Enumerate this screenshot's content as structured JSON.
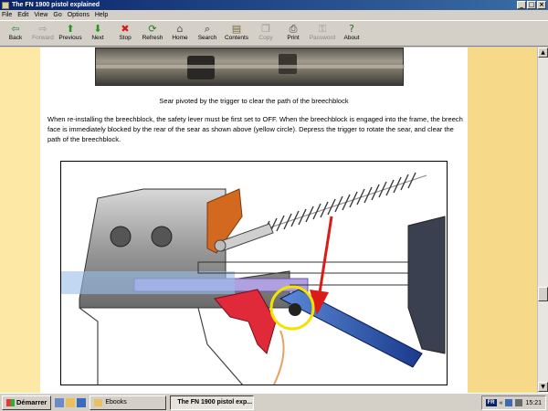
{
  "window": {
    "title": "The FN 1900 pistol explained",
    "buttons": [
      "_",
      "□",
      "×"
    ]
  },
  "menu": [
    "File",
    "Edit",
    "View",
    "Go",
    "Options",
    "Help"
  ],
  "toolbar": [
    {
      "label": "Back",
      "icon": "back-arrow-icon",
      "glyph": "⇦",
      "color": "#2a8a2a",
      "enabled": true
    },
    {
      "label": "Forward",
      "icon": "forward-arrow-icon",
      "glyph": "⇨",
      "color": "#9a9a9a",
      "enabled": false
    },
    {
      "label": "Previous",
      "icon": "up-arrow-icon",
      "glyph": "⬆",
      "color": "#1f9a1f",
      "enabled": true
    },
    {
      "label": "Next",
      "icon": "down-arrow-icon",
      "glyph": "⬇",
      "color": "#1f9a1f",
      "enabled": true
    },
    {
      "label": "Stop",
      "icon": "stop-icon",
      "glyph": "✖",
      "color": "#d21a1a",
      "enabled": true
    },
    {
      "label": "Refresh",
      "icon": "refresh-icon",
      "glyph": "⟳",
      "color": "#2a7a2a",
      "enabled": true
    },
    {
      "label": "Home",
      "icon": "home-icon",
      "glyph": "⌂",
      "color": "#5a5a5a",
      "enabled": true
    },
    {
      "label": "Search",
      "icon": "search-icon",
      "glyph": "⌕",
      "color": "#303030",
      "enabled": true
    },
    {
      "label": "Contents",
      "icon": "contents-icon",
      "glyph": "▤",
      "color": "#7a6a3a",
      "enabled": true
    },
    {
      "label": "Copy",
      "icon": "copy-icon",
      "glyph": "❐",
      "color": "#9a9a9a",
      "enabled": false
    },
    {
      "label": "Print",
      "icon": "print-icon",
      "glyph": "⎙",
      "color": "#404040",
      "enabled": true
    },
    {
      "label": "Password",
      "icon": "key-icon",
      "glyph": "⚿",
      "color": "#9a9a9a",
      "enabled": false
    },
    {
      "label": "About",
      "icon": "about-icon",
      "glyph": "?",
      "color": "#2a6a2a",
      "enabled": true
    }
  ],
  "content": {
    "caption": "Sear pivoted by the trigger to clear the path of the breechblock",
    "paragraph": "When re-installing the breechblock, the safety lever must be first set to OFF. When the breechblock is engaged into the frame, the breech face is immediately blocked by the rear of the sear as shown above (yellow circle). Depress the trigger to rotate the sear, and clear the path of the breechblock."
  },
  "taskbar": {
    "start_label": "Démarrer",
    "tasks": [
      {
        "label": "Ebooks",
        "active": false
      },
      {
        "label": "The FN 1900 pistol exp...",
        "active": true
      }
    ],
    "tray": {
      "lang": "FR",
      "time": "15:21"
    }
  },
  "colors": {
    "titlebar": "#0a246a",
    "page_bg": "#fde8a6",
    "band": "#f7d98a"
  }
}
